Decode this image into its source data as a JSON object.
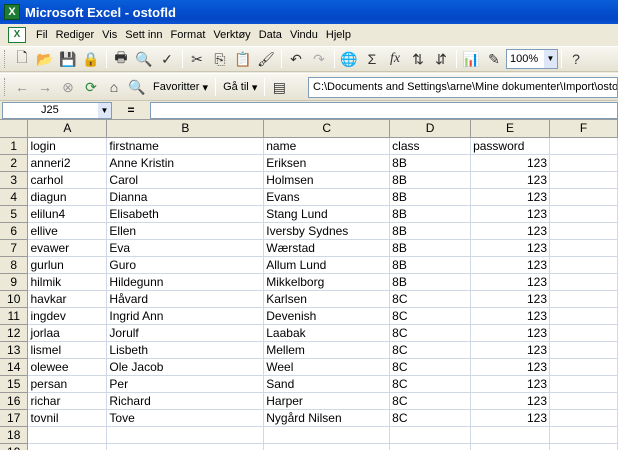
{
  "window": {
    "title": "Microsoft Excel - ostofld",
    "app_icon": "excel-icon"
  },
  "menu": [
    {
      "label": "Fil"
    },
    {
      "label": "Rediger"
    },
    {
      "label": "Vis"
    },
    {
      "label": "Sett inn"
    },
    {
      "label": "Format"
    },
    {
      "label": "Verktøy"
    },
    {
      "label": "Data"
    },
    {
      "label": "Vindu"
    },
    {
      "label": "Hjelp"
    }
  ],
  "toolbar": {
    "zoom": "100%",
    "sum_symbol": "Σ",
    "fx_symbol": "fx"
  },
  "webbar": {
    "favorites_label": "Favoritter",
    "goto_label": "Gå til",
    "address": "C:\\Documents and Settings\\arne\\Mine dokumenter\\Import\\ostofld.xls"
  },
  "formula": {
    "cell_ref": "J25",
    "equals": "=",
    "value": ""
  },
  "grid": {
    "columns": [
      "A",
      "B",
      "C",
      "D",
      "E",
      "F"
    ],
    "rows": [
      [
        "login",
        "firstname",
        "name",
        "class",
        "password"
      ],
      [
        "anneri2",
        "Anne Kristin",
        "Eriksen",
        "8B",
        "123"
      ],
      [
        "carhol",
        "Carol",
        "Holmsen",
        "8B",
        "123"
      ],
      [
        "diagun",
        "Dianna",
        "Evans",
        "8B",
        "123"
      ],
      [
        "elilun4",
        "Elisabeth",
        "Stang Lund",
        "8B",
        "123"
      ],
      [
        "ellive",
        "Ellen",
        "Iversby Sydnes",
        "8B",
        "123"
      ],
      [
        "evawer",
        "Eva",
        "Wærstad",
        "8B",
        "123"
      ],
      [
        "gurlun",
        "Guro",
        "Allum Lund",
        "8B",
        "123"
      ],
      [
        "hilmik",
        "Hildegunn",
        "Mikkelborg",
        "8B",
        "123"
      ],
      [
        "havkar",
        "Håvard",
        "Karlsen",
        "8C",
        "123"
      ],
      [
        "ingdev",
        "Ingrid Ann",
        "Devenish",
        "8C",
        "123"
      ],
      [
        "jorlaa",
        "Jorulf",
        "Laabak",
        "8C",
        "123"
      ],
      [
        "lismel",
        "Lisbeth",
        "Mellem",
        "8C",
        "123"
      ],
      [
        "olewee",
        "Ole Jacob",
        "Weel",
        "8C",
        "123"
      ],
      [
        "persan",
        "Per",
        "Sand",
        "8C",
        "123"
      ],
      [
        "richar",
        "Richard",
        "Harper",
        "8C",
        "123"
      ],
      [
        "tovnil",
        "Tove",
        "Nygård Nilsen",
        "8C",
        "123"
      ],
      [
        "",
        "",
        "",
        "",
        ""
      ],
      [
        "",
        "",
        "",
        "",
        ""
      ]
    ]
  }
}
